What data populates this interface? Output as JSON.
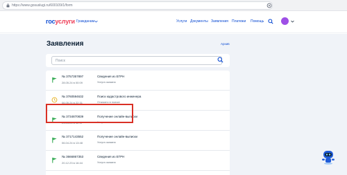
{
  "browser": {
    "url": "https://www.gosuslugi.ru/600109/1/form"
  },
  "header": {
    "logo_part1": "гос",
    "logo_part2": "услуги",
    "role": "Гражданам",
    "nav": [
      "Услуги",
      "Документы",
      "Заявления",
      "Платежи",
      "Помощь"
    ],
    "accent": "#0d4cd3",
    "avatar_color": "#9e4fe6"
  },
  "page": {
    "title": "Заявления",
    "archive_link": "Архив",
    "search_placeholder": "Поиск"
  },
  "applications": [
    {
      "number": "№ 3757357897",
      "date": "28.05.24 в 00:09",
      "title": "Сведения из ЕГРН",
      "status": "Услуга оказана",
      "icon": "flag-icon"
    },
    {
      "number": "№ 3760594632",
      "date": "06.05.24 в 22:31",
      "title": "Поиск кадастрового инженера",
      "status": "Отказано в поиске",
      "icon": "clock-icon"
    },
    {
      "number": "№ 3734870839",
      "date": "23.04.24 в 12:37",
      "title": "Получение онлайн-выписки",
      "status": "Услуга оказана",
      "icon": "flag-icon"
    },
    {
      "number": "№ 3717143552",
      "date": "06.04.24 в 13:48",
      "title": "Получение онлайн-выписки",
      "status": "Услуга оказана",
      "icon": "flag-icon"
    },
    {
      "number": "№ 3666867353",
      "date": "20.12.23 в 16:44",
      "title": "Сведения из ЕГРН",
      "status": "Услуга оказана",
      "icon": "flag-icon"
    }
  ],
  "colors": {
    "flag_green": "#2fa84f",
    "clock_yellow": "#e8b62e",
    "highlight_red": "#d93025"
  }
}
